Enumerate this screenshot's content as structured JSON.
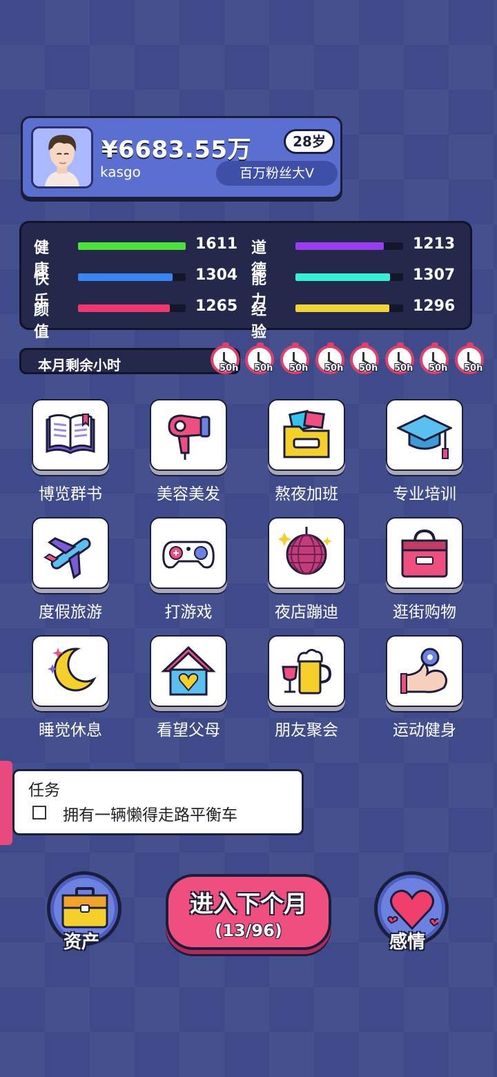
{
  "player": {
    "money": "¥6683.55万",
    "age": "28岁",
    "username": "kasgo",
    "title": "百万粉丝大V"
  },
  "stats": [
    {
      "label": "健康",
      "value": "1611",
      "color": "#4be33a",
      "level": 1.0
    },
    {
      "label": "道德",
      "value": "1213",
      "color": "#9a3cf0",
      "level": 0.82
    },
    {
      "label": "快乐",
      "value": "1304",
      "color": "#3a86f0",
      "level": 0.88
    },
    {
      "label": "能力",
      "value": "1307",
      "color": "#34f0d6",
      "level": 0.88
    },
    {
      "label": "颜值",
      "value": "1265",
      "color": "#f0386e",
      "level": 0.85
    },
    {
      "label": "经验",
      "value": "1296",
      "color": "#f0d632",
      "level": 0.87
    }
  ],
  "hours": {
    "label": "本月剩余小时",
    "clocks": [
      "50h",
      "50h",
      "50h",
      "50h",
      "50h",
      "50h",
      "50h",
      "50h"
    ]
  },
  "actions": [
    {
      "label": "博览群书",
      "icon": "book-icon"
    },
    {
      "label": "美容美发",
      "icon": "hair-dryer-icon"
    },
    {
      "label": "熬夜加班",
      "icon": "folder-icon"
    },
    {
      "label": "专业培训",
      "icon": "graduation-cap-icon"
    },
    {
      "label": "度假旅游",
      "icon": "airplane-icon"
    },
    {
      "label": "打游戏",
      "icon": "gamepad-icon"
    },
    {
      "label": "夜店蹦迪",
      "icon": "disco-ball-icon"
    },
    {
      "label": "逛街购物",
      "icon": "shopping-bag-icon"
    },
    {
      "label": "睡觉休息",
      "icon": "moon-icon"
    },
    {
      "label": "看望父母",
      "icon": "house-heart-icon"
    },
    {
      "label": "朋友聚会",
      "icon": "beer-icon"
    },
    {
      "label": "运动健身",
      "icon": "muscle-icon"
    }
  ],
  "task": {
    "title": "任务",
    "items": [
      "拥有一辆懒得走路平衡车"
    ],
    "checked": [
      false
    ]
  },
  "bottom": {
    "assets_label": "资产",
    "next_month_label": "进入下个月",
    "next_month_count": "(13/96)",
    "love_label": "感情"
  }
}
